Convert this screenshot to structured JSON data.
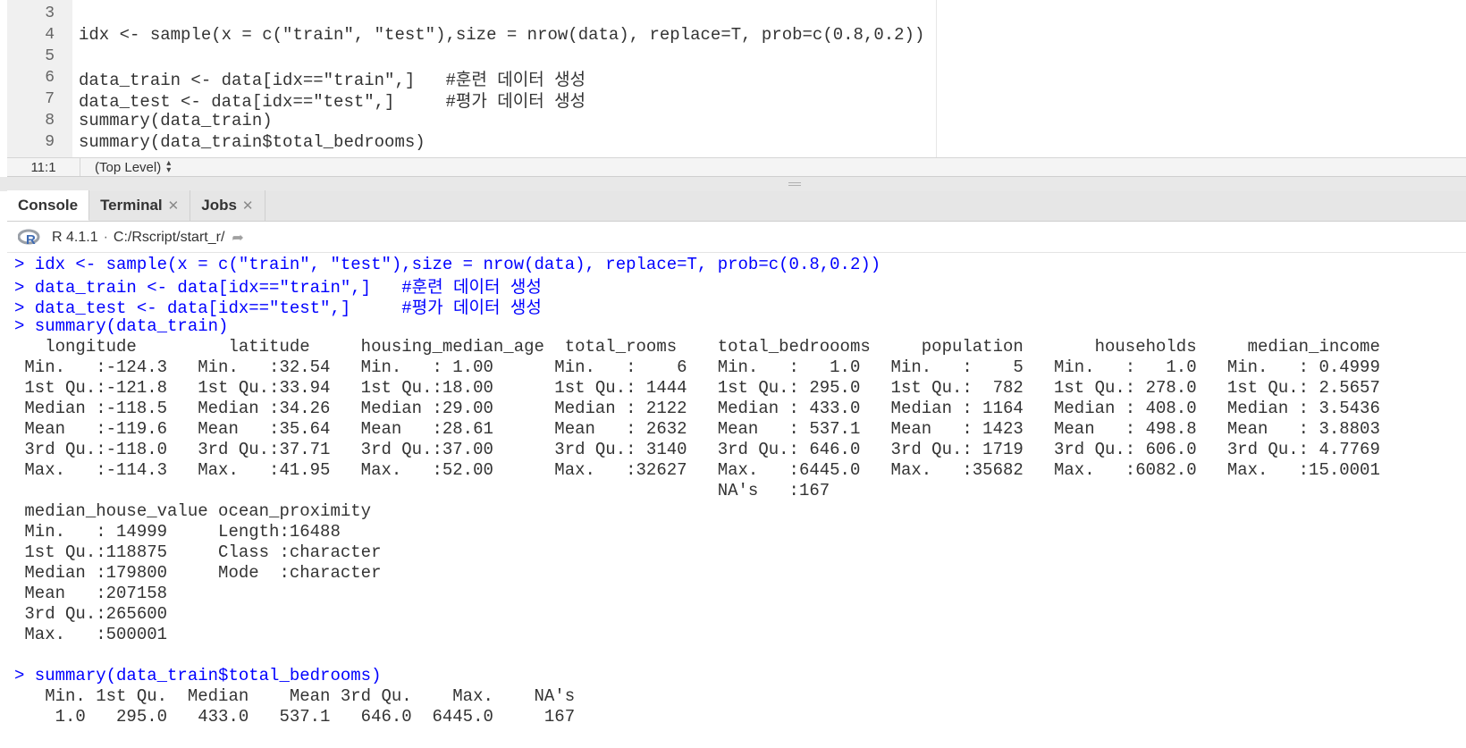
{
  "editor": {
    "lines": [
      {
        "num": "3",
        "code": ""
      },
      {
        "num": "4",
        "code": "idx <- sample(x = c(\"train\", \"test\"),size = nrow(data), replace=T, prob=c(0.8,0.2))"
      },
      {
        "num": "5",
        "code": ""
      },
      {
        "num": "6",
        "code": "data_train <- data[idx==\"train\",]   #훈련 데이터 생성"
      },
      {
        "num": "7",
        "code": "data_test <- data[idx==\"test\",]     #평가 데이터 생성"
      },
      {
        "num": "8",
        "code": "summary(data_train)"
      },
      {
        "num": "9",
        "code": "summary(data_train$total_bedrooms)"
      }
    ],
    "status": {
      "cursor": "11:1",
      "scope": "(Top Level)"
    }
  },
  "tabs": [
    {
      "label": "Console",
      "closable": false
    },
    {
      "label": "Terminal",
      "closable": true
    },
    {
      "label": "Jobs",
      "closable": true
    }
  ],
  "console_header": {
    "version": "R 4.1.1",
    "path": "C:/Rscript/start_r/"
  },
  "console": {
    "lines": [
      {
        "type": "input",
        "text": "> idx <- sample(x = c(\"train\", \"test\"),size = nrow(data), replace=T, prob=c(0.8,0.2))"
      },
      {
        "type": "input",
        "text": "> data_train <- data[idx==\"train\",]   #훈련 데이터 생성"
      },
      {
        "type": "input",
        "text": "> data_test <- data[idx==\"test\",]     #평가 데이터 생성"
      },
      {
        "type": "input",
        "text": "> summary(data_train)"
      },
      {
        "type": "output",
        "text": "   longitude         latitude     housing_median_age  total_rooms    total_bedroooms     population       households     median_income"
      },
      {
        "type": "output",
        "text": " Min.   :-124.3   Min.   :32.54   Min.   : 1.00      Min.   :    6   Min.   :   1.0   Min.   :    5   Min.   :   1.0   Min.   : 0.4999"
      },
      {
        "type": "output",
        "text": " 1st Qu.:-121.8   1st Qu.:33.94   1st Qu.:18.00      1st Qu.: 1444   1st Qu.: 295.0   1st Qu.:  782   1st Qu.: 278.0   1st Qu.: 2.5657"
      },
      {
        "type": "output",
        "text": " Median :-118.5   Median :34.26   Median :29.00      Median : 2122   Median : 433.0   Median : 1164   Median : 408.0   Median : 3.5436"
      },
      {
        "type": "output",
        "text": " Mean   :-119.6   Mean   :35.64   Mean   :28.61      Mean   : 2632   Mean   : 537.1   Mean   : 1423   Mean   : 498.8   Mean   : 3.8803"
      },
      {
        "type": "output",
        "text": " 3rd Qu.:-118.0   3rd Qu.:37.71   3rd Qu.:37.00      3rd Qu.: 3140   3rd Qu.: 646.0   3rd Qu.: 1719   3rd Qu.: 606.0   3rd Qu.: 4.7769"
      },
      {
        "type": "output",
        "text": " Max.   :-114.3   Max.   :41.95   Max.   :52.00      Max.   :32627   Max.   :6445.0   Max.   :35682   Max.   :6082.0   Max.   :15.0001"
      },
      {
        "type": "output",
        "text": "                                                                     NA's   :167"
      },
      {
        "type": "output",
        "text": " median_house_value ocean_proximity"
      },
      {
        "type": "output",
        "text": " Min.   : 14999     Length:16488"
      },
      {
        "type": "output",
        "text": " 1st Qu.:118875     Class :character"
      },
      {
        "type": "output",
        "text": " Median :179800     Mode  :character"
      },
      {
        "type": "output",
        "text": " Mean   :207158"
      },
      {
        "type": "output",
        "text": " 3rd Qu.:265600"
      },
      {
        "type": "output",
        "text": " Max.   :500001"
      },
      {
        "type": "output",
        "text": ""
      },
      {
        "type": "input",
        "text": "> summary(data_train$total_bedrooms)"
      },
      {
        "type": "output",
        "text": "   Min. 1st Qu.  Median    Mean 3rd Qu.    Max.    NA's"
      },
      {
        "type": "output",
        "text": "    1.0   295.0   433.0   537.1   646.0  6445.0     167"
      }
    ]
  }
}
